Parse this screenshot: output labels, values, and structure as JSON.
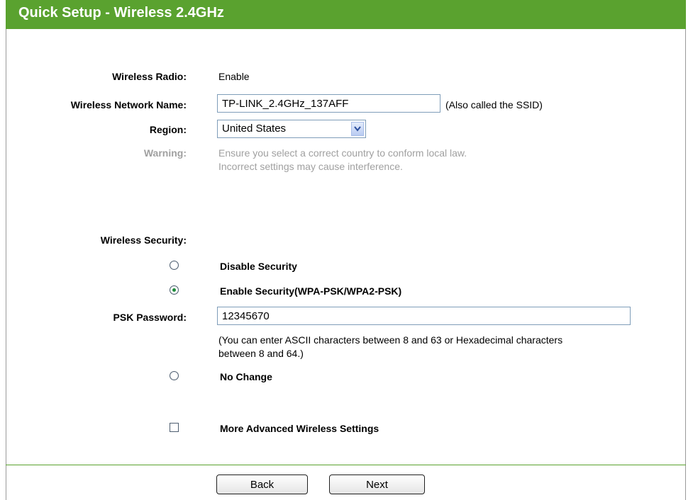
{
  "header": {
    "title": "Quick Setup - Wireless 2.4GHz"
  },
  "wireless_radio": {
    "label": "Wireless Radio:",
    "value": "Enable"
  },
  "network_name": {
    "label": "Wireless Network Name:",
    "value": "TP-LINK_2.4GHz_137AFF",
    "hint": "(Also called the SSID)"
  },
  "region": {
    "label": "Region:",
    "selected": "United States"
  },
  "warning": {
    "label": "Warning:",
    "line1": "Ensure you select a correct country to conform local law.",
    "line2": "Incorrect settings may cause interference."
  },
  "security": {
    "label": "Wireless Security:",
    "options": [
      {
        "label": "Disable Security",
        "checked": false
      },
      {
        "label": "Enable Security(WPA-PSK/WPA2-PSK)",
        "checked": true
      },
      {
        "label": "No Change",
        "checked": false
      }
    ]
  },
  "psk": {
    "label": "PSK Password:",
    "value": "12345670",
    "hint_line1": "(You can enter ASCII characters between 8 and 63 or Hexadecimal characters",
    "hint_line2": "between 8 and 64.)"
  },
  "advanced": {
    "label": "More Advanced Wireless Settings",
    "checked": false
  },
  "buttons": {
    "back": "Back",
    "next": "Next"
  },
  "colors": {
    "header_bg": "#5aa22f",
    "header_text": "#ffffff",
    "warning_text": "#a0a0a0"
  }
}
